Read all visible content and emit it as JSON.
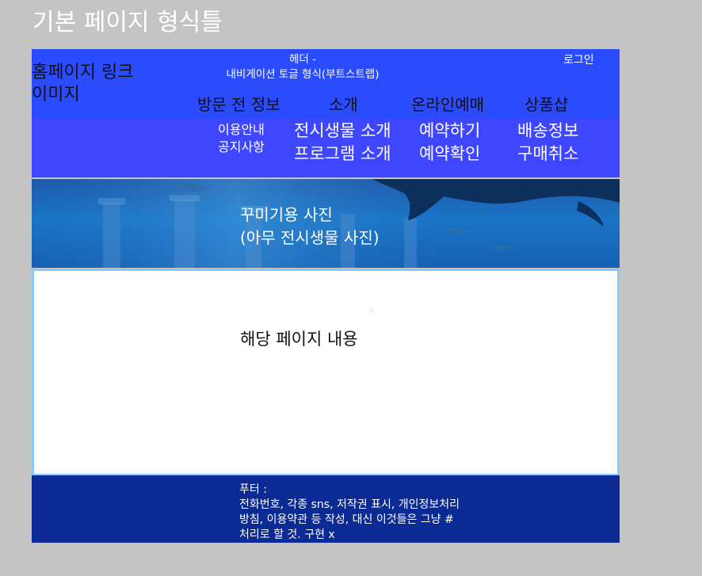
{
  "page": {
    "heading": "기본 페이지 형식틀"
  },
  "header": {
    "logo_line1": "홈페이지 링크",
    "logo_line2": "이미지",
    "note_line1": "헤더 -",
    "note_line2": "내비게이션 토글 형식(부트스트랩)",
    "login": "로그인",
    "nav": [
      {
        "label": "방문 전 정보"
      },
      {
        "label": "소개"
      },
      {
        "label": "온라인예매"
      },
      {
        "label": "상품샵"
      }
    ]
  },
  "subnav": {
    "visit": [
      "이용안내",
      "공지사항"
    ],
    "intro": [
      "전시생물 소개",
      "프로그램 소개"
    ],
    "booking": [
      "예약하기",
      "예약확인"
    ],
    "shop": [
      "배송정보",
      "구매취소"
    ]
  },
  "banner": {
    "line1": "꾸미기용 사진",
    "line2": "(아무 전시생물 사진)"
  },
  "content": {
    "dot": "::",
    "text": "해당 페이지 내용"
  },
  "footer": {
    "lines": [
      "푸터 :",
      "전화번호, 각종 sns, 저작권 표시, 개인정보처리",
      "방침, 이용약관 등 작성, 대신 이것들은 그냥 #",
      "처리로 할 것. 구현 x"
    ]
  },
  "colors": {
    "background": "#c4c4c4",
    "header": "#2b4bff",
    "subnav": "#3f46ff",
    "content_border": "#8cc8f5",
    "footer": "#0c2a93"
  }
}
